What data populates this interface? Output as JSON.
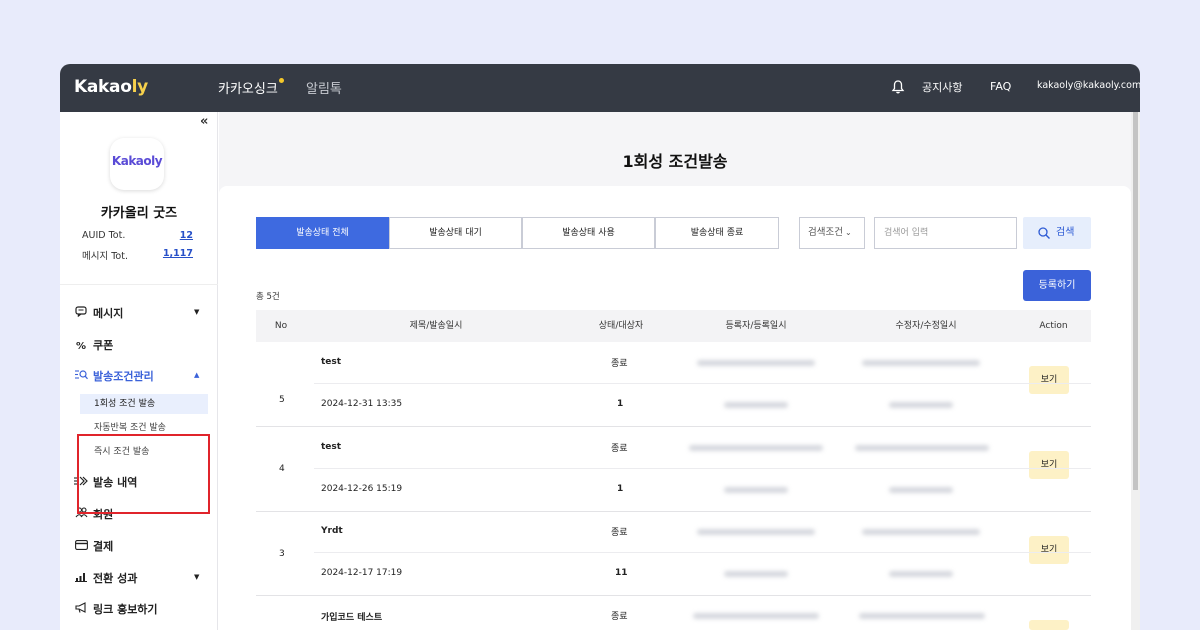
{
  "topbar": {
    "logo_main": "Kakao",
    "logo_accent": "ly",
    "nav_primary": "카카오싱크",
    "nav_secondary": "알림톡",
    "notice_label": "공지사항",
    "faq_label": "FAQ",
    "email": "kakaoly@kakaoly.com"
  },
  "sidebar": {
    "collapse_glyph": "«",
    "store_logo_text": "Kakaoly",
    "store_name": "카카올리 굿즈",
    "stats": [
      {
        "label": "AUID Tot.",
        "value": "12"
      },
      {
        "label": "메시지 Tot.",
        "value": "1,117"
      }
    ],
    "menu": [
      {
        "label": "메시지",
        "icon": "message-icon"
      },
      {
        "label": "쿠폰",
        "icon": "percent-icon"
      },
      {
        "label": "발송조건관리",
        "icon": "condition-search-icon"
      },
      {
        "label": "발송 내역",
        "icon": "send-history-icon"
      },
      {
        "label": "회원",
        "icon": "members-icon"
      },
      {
        "label": "결제",
        "icon": "card-icon"
      },
      {
        "label": "전환 성과",
        "icon": "bar-chart-icon"
      },
      {
        "label": "링크 홍보하기",
        "icon": "megaphone-icon"
      }
    ],
    "submenu": [
      {
        "label": "1회성 조건 발송"
      },
      {
        "label": "자동반복 조건 발송"
      },
      {
        "label": "즉시 조건 발송"
      }
    ]
  },
  "main": {
    "title": "1회성 조건발송",
    "tabs": [
      {
        "label": "발송상태 전체"
      },
      {
        "label": "발송상태 대기"
      },
      {
        "label": "발송상태 사용"
      },
      {
        "label": "발송상태 종료"
      }
    ],
    "search": {
      "condition_label": "검색조건",
      "placeholder": "검색어 입력",
      "button_label": "검색"
    },
    "total_label": "총 5건",
    "register_label": "등록하기",
    "table": {
      "headers": [
        "No",
        "제목/발송일시",
        "상태/대상자",
        "등록자/등록일시",
        "수정자/수정일시",
        "Action"
      ],
      "rows": [
        {
          "no": "5",
          "title": "test",
          "datetime": "2024-12-31 13:35",
          "status": "종료",
          "count": "1",
          "action": "보기"
        },
        {
          "no": "4",
          "title": "test",
          "datetime": "2024-12-26 15:19",
          "status": "종료",
          "count": "1",
          "action": "보기"
        },
        {
          "no": "3",
          "title": "Yrdt",
          "datetime": "2024-12-17 17:19",
          "status": "종료",
          "count": "11",
          "action": "보기"
        },
        {
          "no": "",
          "title": "가입코드 테스트",
          "datetime": "",
          "status": "종료",
          "count": "",
          "action": ""
        }
      ]
    }
  },
  "colors": {
    "topbar_bg": "#353a44",
    "accent_blue": "#3e6ae0",
    "logo_yellow": "#f7d14c",
    "highlight_red": "#e0242b",
    "view_button_bg": "#fdf1c6"
  }
}
